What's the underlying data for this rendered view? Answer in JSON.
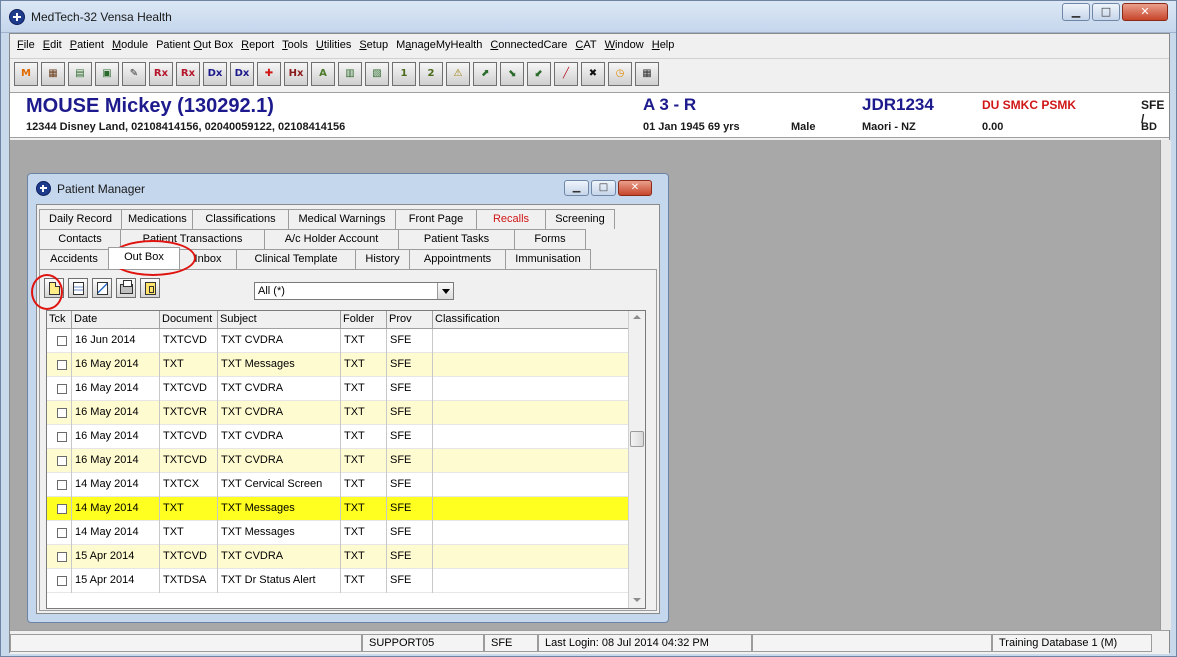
{
  "window": {
    "title": "MedTech-32  Vensa Health"
  },
  "menu": [
    {
      "pre": "",
      "u": "F",
      "post": "ile"
    },
    {
      "pre": "",
      "u": "E",
      "post": "dit"
    },
    {
      "pre": "",
      "u": "P",
      "post": "atient"
    },
    {
      "pre": "",
      "u": "M",
      "post": "odule"
    },
    {
      "pre": "Patient ",
      "u": "O",
      "post": "ut Box"
    },
    {
      "pre": "",
      "u": "R",
      "post": "eport"
    },
    {
      "pre": "",
      "u": "T",
      "post": "ools"
    },
    {
      "pre": "",
      "u": "U",
      "post": "tilities"
    },
    {
      "pre": "",
      "u": "S",
      "post": "etup"
    },
    {
      "pre": "M",
      "u": "a",
      "post": "nageMyHealth"
    },
    {
      "pre": "",
      "u": "C",
      "post": "onnectedCare"
    },
    {
      "pre": "",
      "u": "C",
      "post": "AT"
    },
    {
      "pre": "",
      "u": "W",
      "post": "indow"
    },
    {
      "pre": "",
      "u": "H",
      "post": "elp"
    }
  ],
  "toolbar_icons": [
    {
      "name": "mmh-icon",
      "glyph": "M",
      "color": "#e06a00"
    },
    {
      "name": "calculator-icon",
      "glyph": "▦",
      "color": "#6a3d1c"
    },
    {
      "name": "patient-register-icon",
      "glyph": "▤",
      "color": "#2b6b2b"
    },
    {
      "name": "image-icon",
      "glyph": "▣",
      "color": "#2b6b2b"
    },
    {
      "name": "sign-icon",
      "glyph": "✎",
      "color": "#333333"
    },
    {
      "name": "rx-repeat-icon",
      "glyph": "Rx",
      "color": "#b5162b"
    },
    {
      "name": "rx-icon",
      "glyph": "Rx",
      "color": "#b5162b"
    },
    {
      "name": "dx-list-icon",
      "glyph": "Dx",
      "color": "#1c1a8c"
    },
    {
      "name": "dx-icon",
      "glyph": "Dx",
      "color": "#1c1a8c"
    },
    {
      "name": "medical-cross-icon",
      "glyph": "✚",
      "color": "#d11616"
    },
    {
      "name": "hx-icon",
      "glyph": "Hx",
      "color": "#8a1a1a"
    },
    {
      "name": "acc-icon",
      "glyph": "A",
      "color": "#4a7a2a"
    },
    {
      "name": "acc-form-icon",
      "glyph": "▥",
      "color": "#2b6b2b"
    },
    {
      "name": "mmh-chart-icon",
      "glyph": "▧",
      "color": "#2b6b2b"
    },
    {
      "name": "number-one-icon",
      "glyph": "1",
      "color": "#4a6a1a"
    },
    {
      "name": "number-two-icon",
      "glyph": "2",
      "color": "#4a6a1a"
    },
    {
      "name": "warning-icon",
      "glyph": "⚠",
      "color": "#9a7a00"
    },
    {
      "name": "inbox-icon",
      "glyph": "⬈",
      "color": "#2b6b2b"
    },
    {
      "name": "lab-results-icon",
      "glyph": "⬊",
      "color": "#2b6b2b"
    },
    {
      "name": "lab-results-2-icon",
      "glyph": "⬋",
      "color": "#2b6b2b"
    },
    {
      "name": "pen-icon",
      "glyph": "╱",
      "color": "#b5162b"
    },
    {
      "name": "close-patient-icon",
      "glyph": "✖",
      "color": "#111111"
    },
    {
      "name": "clock-icon",
      "glyph": "◷",
      "color": "#e08a00"
    },
    {
      "name": "calculator-2-icon",
      "glyph": "▦",
      "color": "#333333"
    }
  ],
  "patient": {
    "name": "MOUSE Mickey (130292.1)",
    "address": "12344 Disney Land, 02108414156, 02040059122, 02108414156",
    "code": "A 3 - R",
    "dob": "01 Jan 1945 69 yrs",
    "gender": "Male",
    "nhi": "JDR1234",
    "ethnicity": "Maori - NZ",
    "alerts": "DU SMKC PSMK",
    "balance": "0.00",
    "provider": "SFE /",
    "provider2": "BD"
  },
  "patient_manager": {
    "title": "Patient Manager",
    "tabs_row1": [
      "Daily Record",
      "Medications",
      "Classifications",
      "Medical Warnings",
      "Front Page",
      "Recalls",
      "Screening"
    ],
    "tabs_row2": [
      "Contacts",
      "Patient Transactions",
      "A/c Holder Account",
      "Patient Tasks",
      "Forms"
    ],
    "tabs_row3": [
      "Accidents",
      "Out Box",
      "Inbox",
      "Clinical Template",
      "History",
      "Appointments",
      "Immunisation"
    ],
    "active_tab": "Out Box",
    "filter_value": "All (*)",
    "columns": [
      "Tck",
      "Date",
      "Document",
      "Subject",
      "Folder",
      "Prov",
      "Classification"
    ],
    "rows": [
      {
        "date": "16 Jun 2014",
        "document": "TXTCVD",
        "subject": "TXT CVDRA",
        "folder": "TXT",
        "prov": "SFE",
        "classification": "",
        "style": "white"
      },
      {
        "date": "16 May 2014",
        "document": "TXT",
        "subject": "TXT Messages",
        "folder": "TXT",
        "prov": "SFE",
        "classification": "",
        "style": "alt"
      },
      {
        "date": "16 May 2014",
        "document": "TXTCVD",
        "subject": "TXT CVDRA",
        "folder": "TXT",
        "prov": "SFE",
        "classification": "",
        "style": "white"
      },
      {
        "date": "16 May 2014",
        "document": "TXTCVR",
        "subject": "TXT CVDRA",
        "folder": "TXT",
        "prov": "SFE",
        "classification": "",
        "style": "alt"
      },
      {
        "date": "16 May 2014",
        "document": "TXTCVD",
        "subject": "TXT CVDRA",
        "folder": "TXT",
        "prov": "SFE",
        "classification": "",
        "style": "white"
      },
      {
        "date": "16 May 2014",
        "document": "TXTCVD",
        "subject": "TXT CVDRA",
        "folder": "TXT",
        "prov": "SFE",
        "classification": "",
        "style": "alt"
      },
      {
        "date": "14 May 2014",
        "document": "TXTCX",
        "subject": "TXT Cervical Screen",
        "folder": "TXT",
        "prov": "SFE",
        "classification": "",
        "style": "white"
      },
      {
        "date": "14 May 2014",
        "document": "TXT",
        "subject": "TXT Messages",
        "folder": "TXT",
        "prov": "SFE",
        "classification": "",
        "style": "sel"
      },
      {
        "date": "14 May 2014",
        "document": "TXT",
        "subject": "TXT Messages",
        "folder": "TXT",
        "prov": "SFE",
        "classification": "",
        "style": "white"
      },
      {
        "date": "15 Apr 2014",
        "document": "TXTCVD",
        "subject": "TXT CVDRA",
        "folder": "TXT",
        "prov": "SFE",
        "classification": "",
        "style": "alt"
      },
      {
        "date": "15 Apr 2014",
        "document": "TXTDSA",
        "subject": "TXT Dr Status Alert",
        "folder": "TXT",
        "prov": "SFE",
        "classification": "",
        "style": "white"
      }
    ]
  },
  "status_bar": {
    "workstation": "SUPPORT05",
    "user": "SFE",
    "last_login": "Last Login: 08 Jul 2014 04:32 PM",
    "database": "Training Database 1 (M)"
  },
  "colors": {
    "highlight_row": "#ffff20",
    "alt_row": "#fffbd1",
    "annotation": "#e0140f",
    "patient_name": "#1c1a8c",
    "alerts": "#d11616"
  }
}
